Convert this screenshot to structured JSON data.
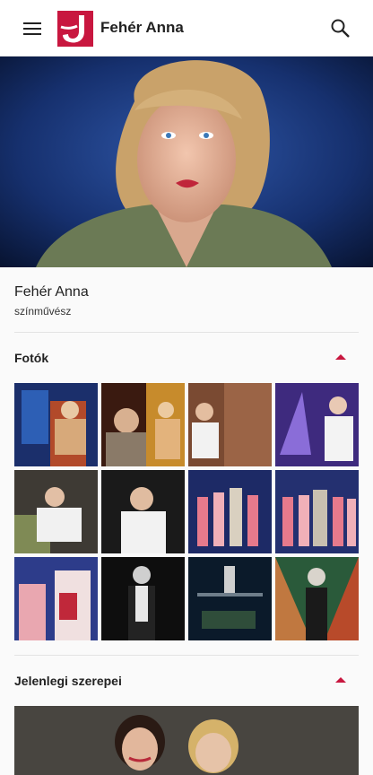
{
  "app": {
    "title": "Fehér Anna",
    "menu_icon": "hamburger-menu-icon",
    "search_icon": "search-icon",
    "logo_icon": "theatre-logo-icon",
    "brand_color": "#c8173f"
  },
  "profile": {
    "name": "Fehér Anna",
    "role": "színművész"
  },
  "sections": {
    "photos": {
      "title": "Fotók",
      "toggle_icon": "chevron-up-icon"
    },
    "roles": {
      "title": "Jelenlegi szerepei",
      "toggle_icon": "chevron-up-icon"
    }
  }
}
